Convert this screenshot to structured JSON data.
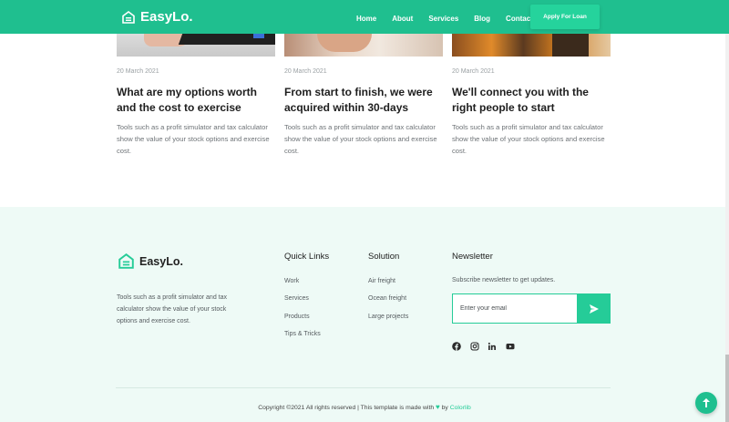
{
  "header": {
    "brand": "EasyLo.",
    "nav": [
      "Home",
      "About",
      "Services",
      "Blog",
      "Contact"
    ],
    "cta": "Apply For Loan"
  },
  "posts": [
    {
      "date": "20 March 2021",
      "title": "What are my options worth and the cost to exercise",
      "desc": "Tools such as a profit simulator and tax calculator show the value of your stock options and exercise cost."
    },
    {
      "date": "20 March 2021",
      "title": "From start to finish, we were acquired within 30-days",
      "desc": "Tools such as a profit simulator and tax calculator show the value of your stock options and exercise cost."
    },
    {
      "date": "20 March 2021",
      "title": "We'll connect you with the right people to start",
      "desc": "Tools such as a profit simulator and tax calculator show the value of your stock options and exercise cost."
    }
  ],
  "footer": {
    "brand": "EasyLo.",
    "about": "Tools such as a profit simulator and tax calculator show the value of your stock options and exercise cost.",
    "quick_links": {
      "title": "Quick Links",
      "items": [
        "Work",
        "Services",
        "Products",
        "Tips & Tricks"
      ]
    },
    "solution": {
      "title": "Solution",
      "items": [
        "Air freight",
        "Ocean freight",
        "Large projects"
      ]
    },
    "newsletter": {
      "title": "Newsletter",
      "subtitle": "Subscribe newsletter to get updates.",
      "placeholder": "Enter your email"
    },
    "socials": [
      "facebook-icon",
      "instagram-icon",
      "linkedin-icon",
      "youtube-icon"
    ],
    "copyright_text": "Copyright ©2021 All rights reserved | This template is made with",
    "copyright_by": "by",
    "copyright_brand": "Colorlib"
  },
  "colors": {
    "accent": "#1fbf8f",
    "accent_bright": "#25cc98",
    "footer_bg": "#eefaf6"
  }
}
